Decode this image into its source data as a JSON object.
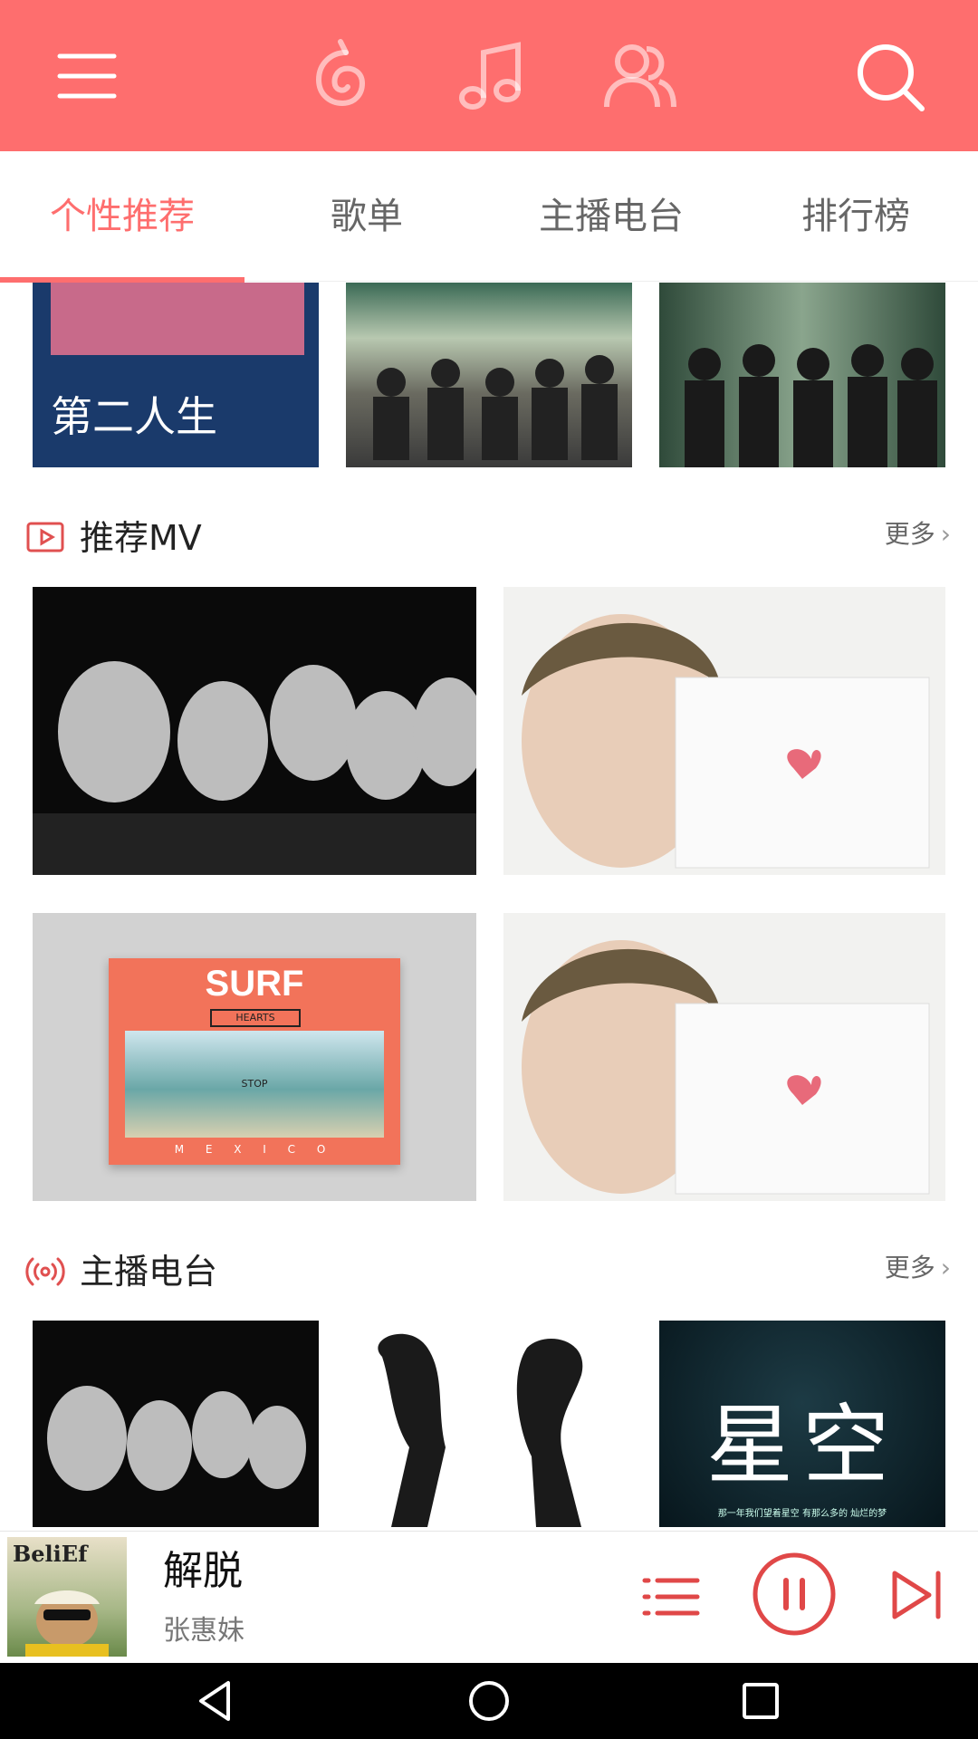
{
  "topbar": {
    "icons": [
      "menu-icon",
      "netease-music-icon",
      "music-note-icon",
      "friends-icon",
      "search-icon"
    ],
    "color": "#fe6e6e"
  },
  "tabs": [
    {
      "label": "个性推荐",
      "active": true
    },
    {
      "label": "歌单",
      "active": false
    },
    {
      "label": "主播电台",
      "active": false
    },
    {
      "label": "排行榜",
      "active": false
    }
  ],
  "playlists_top": [
    {
      "cover_text": "第二人生"
    },
    {
      "cover_text": ""
    },
    {
      "cover_text": ""
    }
  ],
  "mv_section": {
    "title": "推荐MV",
    "more": "更多",
    "icon": "video-icon"
  },
  "radio_section": {
    "title": "主播电台",
    "more": "更多",
    "icon": "radio-icon"
  },
  "surf_card": {
    "title": "SURF",
    "hearts": "HEARTS",
    "stop": "STOP",
    "mexico": "M E X I C O"
  },
  "radio_card_3": {
    "glyphs": "星空",
    "caption": "那一年我们望着星空 有那么多的 灿烂的梦"
  },
  "player": {
    "cover_text": "BeliEf",
    "song": "解脱",
    "artist": "张惠妹",
    "icons": [
      "playlist-icon",
      "pause-icon",
      "next-icon"
    ]
  },
  "navbar": {
    "icons": [
      "back-icon",
      "home-icon",
      "recents-icon"
    ]
  }
}
